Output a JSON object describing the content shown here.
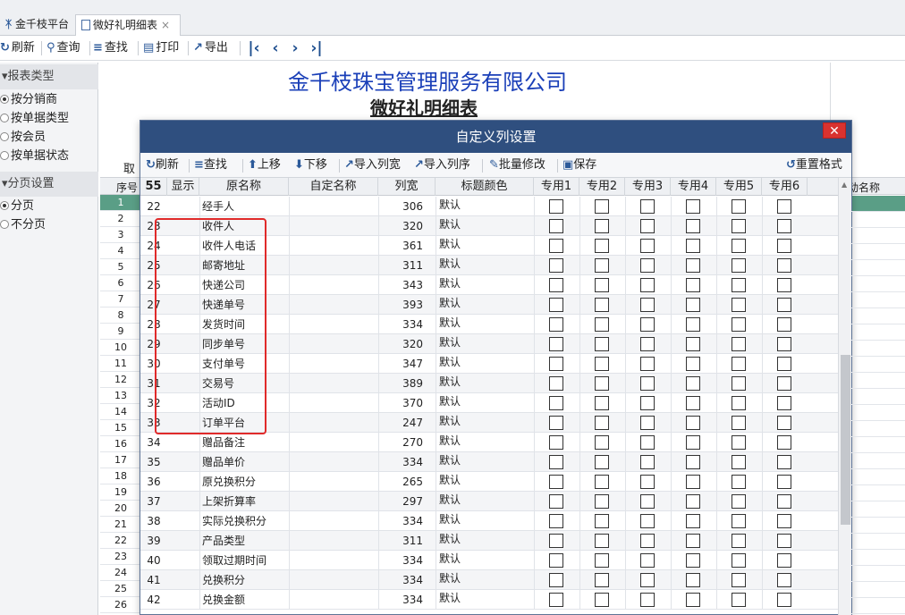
{
  "tabs": [
    {
      "label": "金千枝平台",
      "icon": "app-logo-icon"
    },
    {
      "label": "微好礼明细表",
      "icon": "document-icon",
      "close": "×"
    }
  ],
  "toolbar": {
    "refresh": "刷新",
    "query": "查询",
    "find": "查找",
    "print": "打印",
    "export": "导出",
    "nav": [
      "K",
      "<",
      ">",
      "K"
    ]
  },
  "left_panel": {
    "report_type_header": "报表类型",
    "report_types": [
      {
        "label": "按分销商",
        "selected": true
      },
      {
        "label": "按单据类型",
        "selected": false
      },
      {
        "label": "按会员",
        "selected": false
      },
      {
        "label": "按单据状态",
        "selected": false
      }
    ],
    "paging_header": "分页设置",
    "paging": [
      {
        "label": "分页",
        "selected": true
      },
      {
        "label": "不分页",
        "selected": false
      }
    ]
  },
  "report": {
    "company": "金千枝珠宝管理服务有限公司",
    "title": "微好礼明细表",
    "truncated_label": "取",
    "seq_header": "序号",
    "right_header": "动名称",
    "row_numbers": [
      "1",
      "2",
      "3",
      "4",
      "5",
      "6",
      "7",
      "8",
      "9",
      "10",
      "11",
      "12",
      "13",
      "14",
      "15",
      "16",
      "17",
      "18",
      "19",
      "20",
      "21",
      "22",
      "23",
      "24",
      "25",
      "26"
    ]
  },
  "dialog": {
    "title": "自定义列设置",
    "close": "✕",
    "toolbar": {
      "refresh": "刷新",
      "find": "查找",
      "move_up": "上移",
      "move_down": "下移",
      "import_width": "导入列宽",
      "import_order": "导入列序",
      "batch_edit": "批量修改",
      "save": "保存",
      "reset": "重置格式"
    },
    "grid_headers": {
      "count": "55",
      "show": "显示",
      "name": "原名称",
      "custom": "自定名称",
      "width": "列宽",
      "color": "标题颜色",
      "u1": "专用1",
      "u2": "专用2",
      "u3": "专用3",
      "u4": "专用4",
      "u5": "专用5",
      "u6": "专用6"
    },
    "rows": [
      {
        "no": "22",
        "show": true,
        "name": "经手人",
        "custom": "",
        "width": "306",
        "color": "默认"
      },
      {
        "no": "23",
        "show": true,
        "name": "收件人",
        "custom": "",
        "width": "320",
        "color": "默认"
      },
      {
        "no": "24",
        "show": true,
        "name": "收件人电话",
        "custom": "",
        "width": "361",
        "color": "默认"
      },
      {
        "no": "25",
        "show": true,
        "name": "邮寄地址",
        "custom": "",
        "width": "311",
        "color": "默认"
      },
      {
        "no": "26",
        "show": true,
        "name": "快递公司",
        "custom": "",
        "width": "343",
        "color": "默认"
      },
      {
        "no": "27",
        "show": true,
        "name": "快递单号",
        "custom": "",
        "width": "393",
        "color": "默认"
      },
      {
        "no": "28",
        "show": true,
        "name": "发货时间",
        "custom": "",
        "width": "334",
        "color": "默认"
      },
      {
        "no": "29",
        "show": true,
        "name": "同步单号",
        "custom": "",
        "width": "320",
        "color": "默认"
      },
      {
        "no": "30",
        "show": true,
        "name": "支付单号",
        "custom": "",
        "width": "347",
        "color": "默认"
      },
      {
        "no": "31",
        "show": true,
        "name": "交易号",
        "custom": "",
        "width": "389",
        "color": "默认"
      },
      {
        "no": "32",
        "show": true,
        "name": "活动ID",
        "custom": "",
        "width": "370",
        "color": "默认"
      },
      {
        "no": "33",
        "show": true,
        "name": "订单平台",
        "custom": "",
        "width": "247",
        "color": "默认"
      },
      {
        "no": "34",
        "show": true,
        "name": "赠品备注",
        "custom": "",
        "width": "270",
        "color": "默认"
      },
      {
        "no": "35",
        "show": true,
        "name": "赠品单价",
        "custom": "",
        "width": "334",
        "color": "默认"
      },
      {
        "no": "36",
        "show": true,
        "name": "原兑换积分",
        "custom": "",
        "width": "265",
        "color": "默认"
      },
      {
        "no": "37",
        "show": true,
        "name": "上架折算率",
        "custom": "",
        "width": "297",
        "color": "默认"
      },
      {
        "no": "38",
        "show": true,
        "name": "实际兑换积分",
        "custom": "",
        "width": "334",
        "color": "默认"
      },
      {
        "no": "39",
        "show": true,
        "name": "产品类型",
        "custom": "",
        "width": "311",
        "color": "默认"
      },
      {
        "no": "40",
        "show": true,
        "name": "领取过期时间",
        "custom": "",
        "width": "334",
        "color": "默认"
      },
      {
        "no": "41",
        "show": true,
        "name": "兑换积分",
        "custom": "",
        "width": "334",
        "color": "默认"
      },
      {
        "no": "42",
        "show": true,
        "name": "兑换金额",
        "custom": "",
        "width": "334",
        "color": "默认"
      }
    ]
  },
  "colors": {
    "accent": "#2f4f7f",
    "highlight_row": "#5a9e86",
    "annotation": "#e02a2a",
    "company_text": "#1a3fb8"
  }
}
